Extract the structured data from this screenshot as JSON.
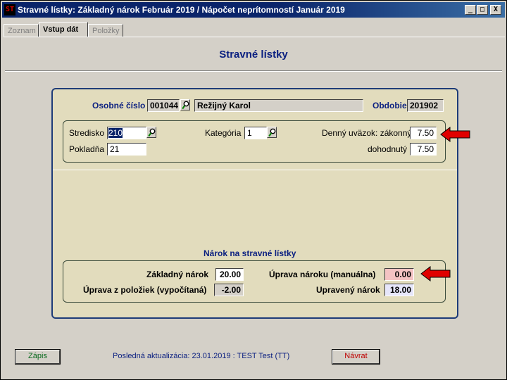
{
  "window": {
    "icon_text": "ST",
    "title": "Stravné lístky:  Základný nárok Február 2019  /  Nápočet neprítomností Január 2019",
    "btn_minimize": "_",
    "btn_maximize": "□",
    "btn_close": "X"
  },
  "tabs": [
    {
      "label": "Zoznam",
      "active": false
    },
    {
      "label": "Vstup dát",
      "active": true
    },
    {
      "label": "Položky",
      "active": false
    }
  ],
  "header": {
    "title": "Stravné lístky"
  },
  "employee": {
    "number_label": "Osobné číslo",
    "number_value": "001044",
    "name_value": "Režijný Karol",
    "period_label": "Obdobie",
    "period_value": "201902"
  },
  "details": {
    "center_label": "Stredisko",
    "center_value": "210",
    "cashdesk_label": "Pokladňa",
    "cashdesk_value": "21",
    "category_label": "Kategória",
    "category_value": "1",
    "workload_statutory_label": "Denný uväzok: zákonný",
    "workload_statutory_value": "7.50",
    "workload_agreed_label": "dohodnutý",
    "workload_agreed_value": "7.50"
  },
  "entitlement": {
    "section_title": "Nárok na stravné lístky",
    "basic_label": "Základný nárok",
    "basic_value": "20.00",
    "items_adjust_label": "Úprava z položiek (vypočítaná)",
    "items_adjust_value": "-2.00",
    "manual_adjust_label": "Úprava nároku (manuálna)",
    "manual_adjust_value": "0.00",
    "adjusted_label": "Upravený nárok",
    "adjusted_value": "18.00"
  },
  "footer": {
    "save_label": "Zápis",
    "status_text": "Posledná aktualizácia: 23.01.2019 : TEST Test  (TT)",
    "back_label": "Návrat"
  },
  "colors": {
    "panel_bg": "#e2dcbd",
    "panel_border": "#1e3c78",
    "title_blue": "#0a1f80",
    "arrow_red": "#e00000",
    "manual_field_pink": "#f4c3c3"
  }
}
